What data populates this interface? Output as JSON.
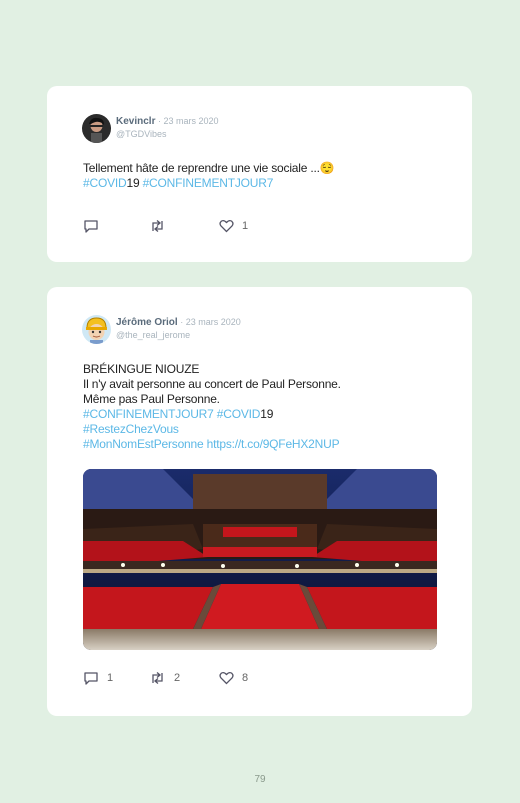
{
  "tweets": [
    {
      "name": "Kevinclr",
      "sep": " · ",
      "date": "23 mars 2020",
      "handle": "@TGDVibes",
      "lines": [
        [
          {
            "t": "Tellement hâte de reprendre une vie sociale ...😌",
            "tag": false
          }
        ],
        [
          {
            "t": "#COVID",
            "tag": true
          },
          {
            "t": "19 ",
            "tag": false
          },
          {
            "t": "#CONFINEMENTJOUR7",
            "tag": true
          }
        ]
      ],
      "replies": "",
      "retweets": "",
      "likes": "1",
      "avatar_icon": "dark-haired-man-avatar"
    },
    {
      "name": "Jérôme Oriol",
      "sep": " · ",
      "date": "23 mars 2020",
      "handle": "@the_real_jerome",
      "lines": [
        [
          {
            "t": "BRÉKINGUE NIOUZE",
            "tag": false
          }
        ],
        [
          {
            "t": "Il n'y avait personne au concert de Paul Personne.",
            "tag": false
          }
        ],
        [
          {
            "t": "Même pas Paul Personne.",
            "tag": false
          }
        ],
        [
          {
            "t": "#CONFINEMENTJOUR7",
            "tag": true
          },
          {
            "t": " ",
            "tag": false
          },
          {
            "t": "#COVID",
            "tag": true
          },
          {
            "t": "19",
            "tag": false
          }
        ],
        [
          {
            "t": "#RestezChezVous",
            "tag": true
          }
        ],
        [
          {
            "t": "#MonNomEstPersonne",
            "tag": true
          },
          {
            "t": " ",
            "tag": false
          },
          {
            "t": "https://t.co/9QFeHX2NUP",
            "tag": true
          }
        ]
      ],
      "replies": "1",
      "retweets": "2",
      "likes": "8",
      "avatar_icon": "cartoon-helmet-avatar",
      "photo": "empty-concert-hall-red-seats"
    }
  ],
  "page_number": "79",
  "colors": {
    "background": "#e1f0e3",
    "hashtag": "#5cb8e6",
    "name": "#5a6b7b",
    "muted": "#a9b4bd"
  }
}
